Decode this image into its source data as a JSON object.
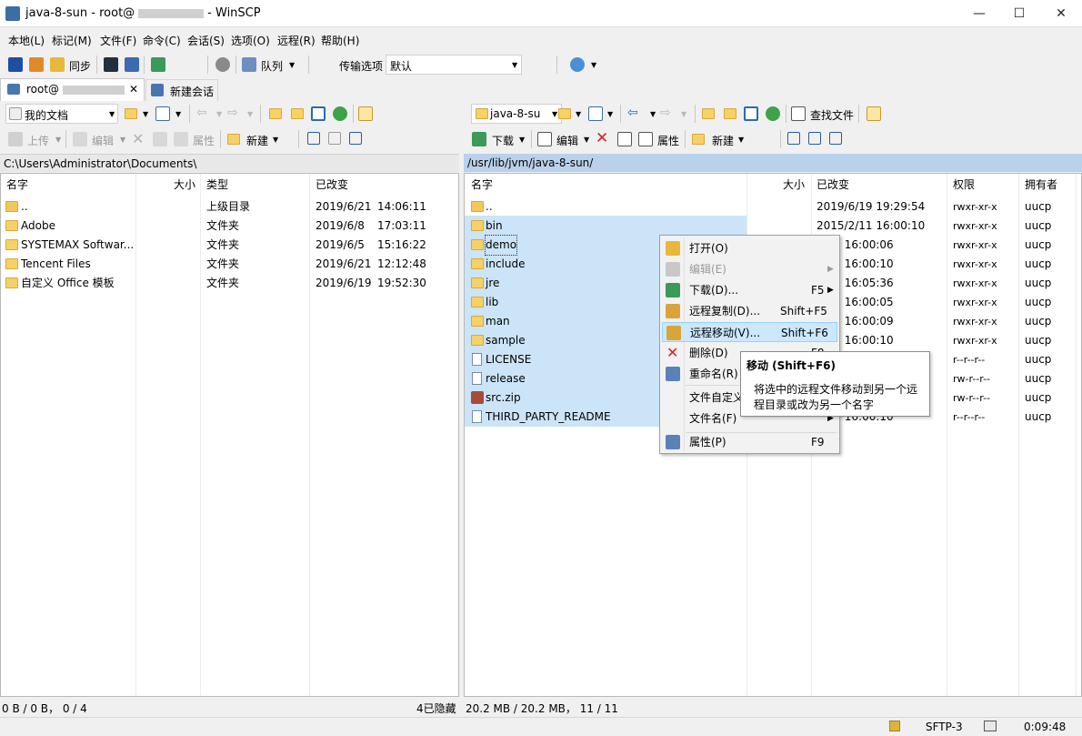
{
  "window": {
    "title_prefix": "java-8-sun - root@",
    "title_suffix": "- WinSCP",
    "minimize": "—",
    "maximize": "☐",
    "close": "✕"
  },
  "menu": [
    "本地(L)",
    "标记(M)",
    "文件(F)",
    "命令(C)",
    "会话(S)",
    "选项(O)",
    "远程(R)",
    "帮助(H)"
  ],
  "toolbar": {
    "sync_label": "同步",
    "queue_label": "队列",
    "transfer_options_label": "传输选项",
    "transfer_options_value": "默认"
  },
  "tabs": {
    "session_label": "root@",
    "close": "✕",
    "new_session_label": "新建会话"
  },
  "local": {
    "location": "我的文档",
    "upload": "上传",
    "edit": "编辑",
    "properties": "属性",
    "new": "新建",
    "path": "C:\\Users\\Administrator\\Documents\\",
    "columns": [
      "名字",
      "大小",
      "类型",
      "已改变"
    ],
    "files": [
      {
        "name": "..",
        "type": "上级目录",
        "date": "2019/6/21",
        "time": "14:06:11",
        "kind": "up"
      },
      {
        "name": "Adobe",
        "type": "文件夹",
        "date": "2019/6/8",
        "time": "17:03:11",
        "kind": "folder"
      },
      {
        "name": "SYSTEMAX Softwar...",
        "type": "文件夹",
        "date": "2019/6/5",
        "time": "15:16:22",
        "kind": "folder"
      },
      {
        "name": "Tencent Files",
        "type": "文件夹",
        "date": "2019/6/21",
        "time": "12:12:48",
        "kind": "folder"
      },
      {
        "name": "自定义 Office 模板",
        "type": "文件夹",
        "date": "2019/6/19",
        "time": "19:52:30",
        "kind": "folder"
      }
    ]
  },
  "remote": {
    "location": "java-8-su",
    "find_files": "查找文件",
    "download": "下载",
    "edit": "编辑",
    "properties": "属性",
    "new": "新建",
    "path": "/usr/lib/jvm/java-8-sun/",
    "columns": [
      "名字",
      "大小",
      "已改变",
      "权限",
      "拥有者"
    ],
    "files": [
      {
        "name": "..",
        "changed": "2019/6/19 19:29:54",
        "perm": "rwxr-xr-x",
        "owner": "uucp",
        "kind": "up"
      },
      {
        "name": "bin",
        "changed": "2015/2/11 16:00:10",
        "perm": "rwxr-xr-x",
        "owner": "uucp",
        "kind": "folder"
      },
      {
        "name": "demo",
        "changed": "2/11 16:00:06",
        "perm": "rwxr-xr-x",
        "owner": "uucp",
        "kind": "folder"
      },
      {
        "name": "include",
        "changed": "2/11 16:00:10",
        "perm": "rwxr-xr-x",
        "owner": "uucp",
        "kind": "folder"
      },
      {
        "name": "jre",
        "changed": "2/11 16:05:36",
        "perm": "rwxr-xr-x",
        "owner": "uucp",
        "kind": "folder"
      },
      {
        "name": "lib",
        "changed": "2/11 16:00:05",
        "perm": "rwxr-xr-x",
        "owner": "uucp",
        "kind": "folder"
      },
      {
        "name": "man",
        "changed": "2/11 16:00:09",
        "perm": "rwxr-xr-x",
        "owner": "uucp",
        "kind": "folder"
      },
      {
        "name": "sample",
        "changed": "2/11 16:00:10",
        "perm": "rwxr-xr-x",
        "owner": "uucp",
        "kind": "folder"
      },
      {
        "name": "LICENSE",
        "changed": "",
        "perm": "r--r--r--",
        "owner": "uucp",
        "kind": "file"
      },
      {
        "name": "release",
        "changed": "",
        "perm": "rw-r--r--",
        "owner": "uucp",
        "kind": "file"
      },
      {
        "name": "src.zip",
        "changed": "",
        "perm": "rw-r--r--",
        "owner": "uucp",
        "kind": "zip"
      },
      {
        "name": "THIRD_PARTY_README",
        "changed": "2/11 16:00:10",
        "perm": "r--r--r--",
        "owner": "uucp",
        "kind": "file"
      }
    ]
  },
  "context_menu": [
    {
      "label": "打开(O)",
      "key": "",
      "icon": "open-icon"
    },
    {
      "label": "编辑(E)",
      "key": "",
      "icon": "edit-icon",
      "disabled": true,
      "submenu": true
    },
    {
      "label": "下载(D)...",
      "key": "F5",
      "icon": "download-icon",
      "submenu": true
    },
    {
      "label": "远程复制(D)...",
      "key": "Shift+F5",
      "icon": "remote-copy-icon"
    },
    {
      "label": "远程移动(V)...",
      "key": "Shift+F6",
      "icon": "remote-move-icon",
      "highlight": true
    },
    {
      "label": "删除(D)",
      "key": "F8",
      "icon": "delete-icon"
    },
    {
      "label": "重命名(R)",
      "key": "",
      "icon": "rename-icon"
    },
    {
      "label": "文件自定义",
      "key": "",
      "icon": ""
    },
    {
      "label": "文件名(F)",
      "key": "",
      "icon": "",
      "submenu": true
    },
    {
      "label": "属性(P)",
      "key": "F9",
      "icon": "properties-icon"
    }
  ],
  "tooltip": {
    "title": "移动 (Shift+F6)",
    "line1": "将选中的远程文件移动到另一个远",
    "line2": "程目录或改为另一个名字"
  },
  "status": {
    "local": "0 B / 0 B， 0 / 4",
    "hidden": "4已隐藏",
    "remote": "20.2 MB / 20.2 MB， 11 / 11",
    "protocol": "SFTP-3",
    "time": "0:09:48"
  },
  "colors": {
    "selection": "#cce4f7",
    "path_active": "#b9d1ea",
    "folder": "#f6d166"
  }
}
